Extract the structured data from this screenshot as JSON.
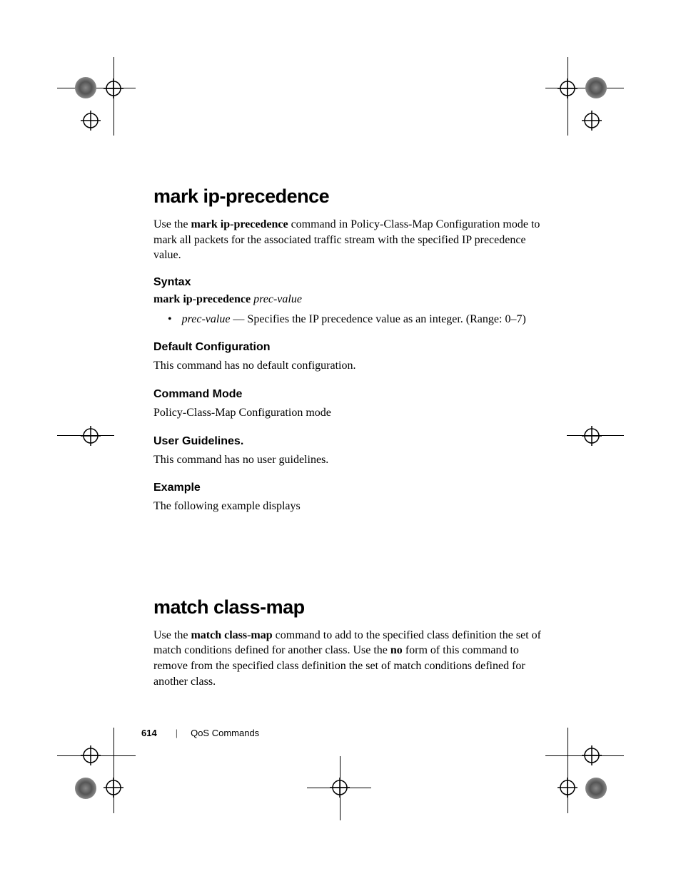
{
  "section1": {
    "title": "mark ip-precedence",
    "intro_pre": "Use the ",
    "intro_bold": "mark ip-precedence",
    "intro_post": " command in Policy-Class-Map Configuration mode to mark all packets for the associated traffic stream with the specified IP precedence value.",
    "syntax": {
      "heading": "Syntax",
      "cmd_bold": "mark ip-precedence ",
      "cmd_italic": "prec-value",
      "bullet_italic": "prec-value",
      "bullet_rest": " — Specifies the IP precedence value as an integer. (Range: 0–7)"
    },
    "default_config": {
      "heading": "Default Configuration",
      "text": "This command has no default configuration."
    },
    "command_mode": {
      "heading": "Command Mode",
      "text": "Policy-Class-Map Configuration mode"
    },
    "user_guidelines": {
      "heading": "User Guidelines.",
      "text": "This command has no user guidelines."
    },
    "example": {
      "heading": "Example",
      "text": "The following example displays"
    }
  },
  "section2": {
    "title": "match class-map",
    "intro_pre": "Use the ",
    "intro_bold1": "match class-map",
    "intro_mid": " command to add to the specified class definition the set of match conditions defined for another class. Use the ",
    "intro_bold2": "no",
    "intro_post": " form of this command to remove from the specified class definition the set of match conditions defined for another class."
  },
  "footer": {
    "page": "614",
    "title": "QoS Commands"
  }
}
